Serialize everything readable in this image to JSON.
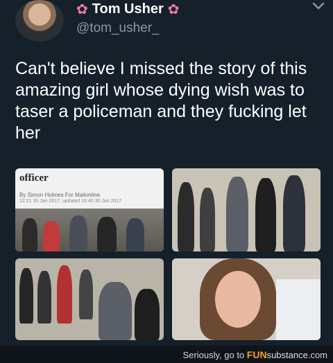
{
  "header": {
    "name": "Tom Usher",
    "handle": "@tom_usher_",
    "icons": [
      "flower-icon",
      "flower-icon",
      "chevron-down-icon"
    ]
  },
  "tweet": {
    "text": "Can't believe I missed the story of this amazing girl whose dying wish was to taser a policeman and they fucking let her"
  },
  "media": {
    "article": {
      "title": "officer",
      "byline": "By Simon Holmes For Mailonline",
      "timestamps": "12:21 30 Jan 2017, updated 16:40 30 Jan 2017"
    }
  },
  "footer": {
    "prefix": "Seriously, go to ",
    "brand_fun": "FUN",
    "brand_sub": "substance",
    "brand_suffix": ".com"
  },
  "colors": {
    "background": "#15202b",
    "handle": "#8899a6",
    "brand_accent": "#f4a21c"
  }
}
